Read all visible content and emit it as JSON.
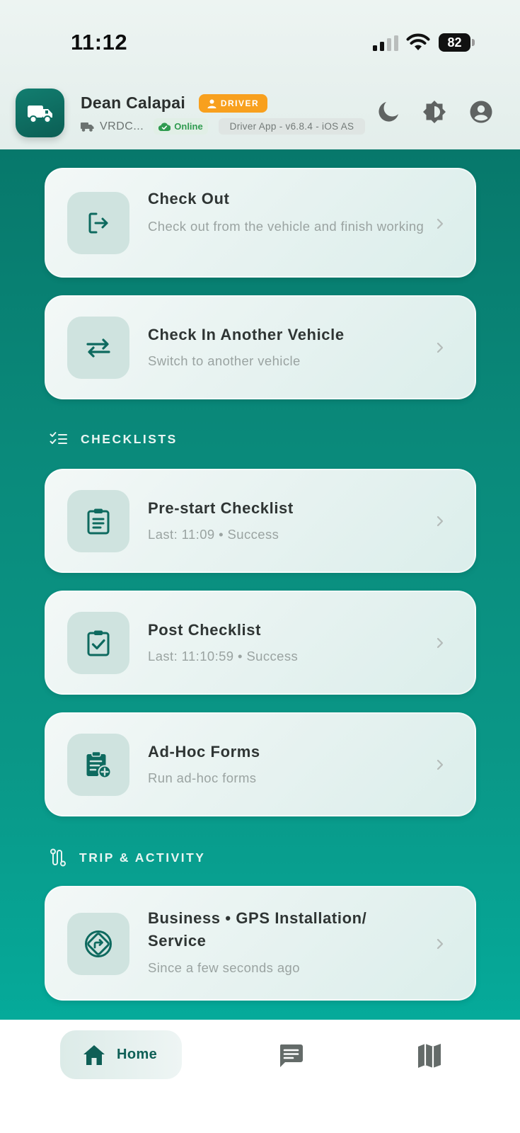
{
  "status_bar": {
    "time": "11:12",
    "battery": "82"
  },
  "header": {
    "driver_name": "Dean Calapai",
    "role_badge": "DRIVER",
    "vehicle_code": "VRDC...",
    "online_status": "Online",
    "app_version": "Driver App - v6.8.4 - iOS AS",
    "icons": [
      "truck-icon",
      "moon-icon",
      "brightness-icon",
      "account-icon"
    ]
  },
  "vehicle_actions": [
    {
      "title": "Check Out",
      "subtitle": "Check out from the vehicle and finish working",
      "icon": "logout-icon"
    },
    {
      "title": "Check In Another Vehicle",
      "subtitle": "Switch to another vehicle",
      "icon": "swap-icon"
    }
  ],
  "checklists": {
    "section_label": "CHECKLISTS",
    "items": [
      {
        "title": "Pre-start Checklist",
        "subtitle": "Last: 11:09 • Success",
        "icon": "clipboard-list-icon"
      },
      {
        "title": "Post Checklist",
        "subtitle": "Last: 11:10:59 • Success",
        "icon": "clipboard-check-icon"
      },
      {
        "title": "Ad-Hoc Forms",
        "subtitle": "Run ad-hoc forms",
        "icon": "clipboard-add-icon"
      }
    ]
  },
  "trip_activity": {
    "section_label": "TRIP & ACTIVITY",
    "items": [
      {
        "title": "Business • GPS Installation/ Service",
        "subtitle": "Since a few seconds ago",
        "icon": "directions-icon"
      }
    ]
  },
  "bottom_nav": {
    "home_label": "Home",
    "items": [
      "home-icon",
      "message-icon",
      "map-icon"
    ]
  },
  "colors": {
    "primary": "#0b7a6d",
    "badge": "#f8a01e",
    "online": "#2f9b4f"
  }
}
